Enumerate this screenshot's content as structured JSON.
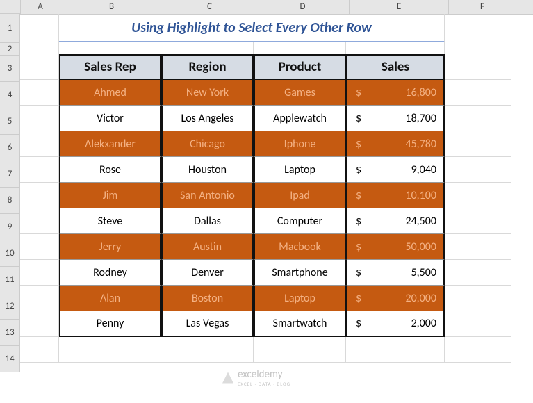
{
  "columns": [
    "A",
    "B",
    "C",
    "D",
    "E",
    "F"
  ],
  "rows": [
    "1",
    "2",
    "3",
    "4",
    "5",
    "6",
    "7",
    "8",
    "9",
    "10",
    "11",
    "12",
    "13",
    "14"
  ],
  "title": "Using Highlight to Select Every Other Row",
  "headers": {
    "b": "Sales Rep",
    "c": "Region",
    "d": "Product",
    "e": "Sales"
  },
  "data": [
    {
      "rep": "Ahmed",
      "region": "New York",
      "product": "Games",
      "currency": "$",
      "sales": "16,800",
      "hl": true
    },
    {
      "rep": "Victor",
      "region": "Los Angeles",
      "product": "Applewatch",
      "currency": "$",
      "sales": "18,700",
      "hl": false
    },
    {
      "rep": "Alekxander",
      "region": "Chicago",
      "product": "Iphone",
      "currency": "$",
      "sales": "45,780",
      "hl": true
    },
    {
      "rep": "Rose",
      "region": "Houston",
      "product": "Laptop",
      "currency": "$",
      "sales": "9,040",
      "hl": false
    },
    {
      "rep": "Jim",
      "region": "San Antonio",
      "product": "Ipad",
      "currency": "$",
      "sales": "10,100",
      "hl": true
    },
    {
      "rep": "Steve",
      "region": "Dallas",
      "product": "Computer",
      "currency": "$",
      "sales": "24,500",
      "hl": false
    },
    {
      "rep": "Jerry",
      "region": "Austin",
      "product": "Macbook",
      "currency": "$",
      "sales": "50,000",
      "hl": true
    },
    {
      "rep": "Rodney",
      "region": "Denver",
      "product": "Smartphone",
      "currency": "$",
      "sales": "5,500",
      "hl": false
    },
    {
      "rep": "Alan",
      "region": "Boston",
      "product": "Laptop",
      "currency": "$",
      "sales": "20,000",
      "hl": true
    },
    {
      "rep": "Penny",
      "region": "Las Vegas",
      "product": "Smartwatch",
      "currency": "$",
      "sales": "2,000",
      "hl": false
    }
  ],
  "watermark": "exceldemy",
  "watermark_sub": "EXCEL · DATA · BLOG",
  "row_heights": {
    "1": 41,
    "2": 17,
    "default": 37
  },
  "chart_data": {
    "type": "table",
    "title": "Using Highlight to Select Every Other Row",
    "columns": [
      "Sales Rep",
      "Region",
      "Product",
      "Sales"
    ],
    "rows": [
      [
        "Ahmed",
        "New York",
        "Games",
        16800
      ],
      [
        "Victor",
        "Los Angeles",
        "Applewatch",
        18700
      ],
      [
        "Alekxander",
        "Chicago",
        "Iphone",
        45780
      ],
      [
        "Rose",
        "Houston",
        "Laptop",
        9040
      ],
      [
        "Jim",
        "San Antonio",
        "Ipad",
        10100
      ],
      [
        "Steve",
        "Dallas",
        "Computer",
        24500
      ],
      [
        "Jerry",
        "Austin",
        "Macbook",
        50000
      ],
      [
        "Rodney",
        "Denver",
        "Smartphone",
        5500
      ],
      [
        "Alan",
        "Boston",
        "Laptop",
        20000
      ],
      [
        "Penny",
        "Las Vegas",
        "Smartwatch",
        2000
      ]
    ]
  }
}
